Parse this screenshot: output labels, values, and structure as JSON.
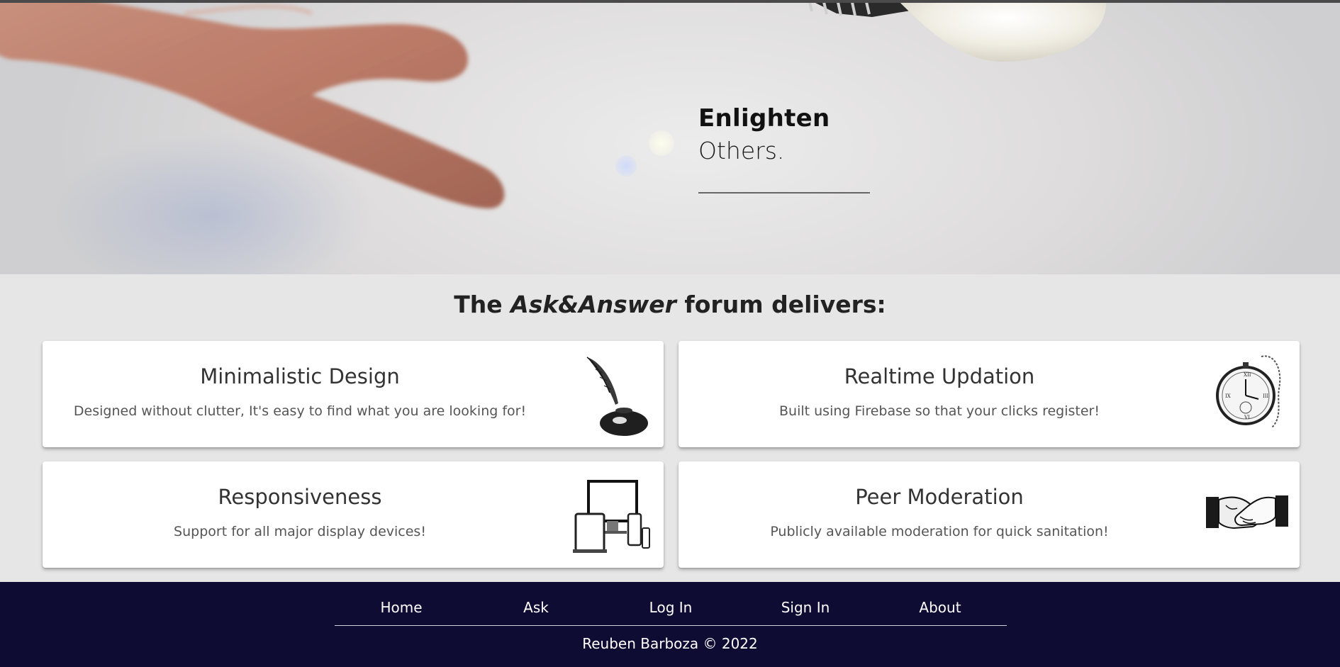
{
  "hero": {
    "line1": "Enlighten",
    "line2": "Others.",
    "illustration": "hand-reaching-lightbulb"
  },
  "features": {
    "title_prefix": "The",
    "title_brand": "Ask&Answer",
    "title_suffix": "forum delivers:",
    "cards": [
      {
        "title": "Minimalistic Design",
        "description": "Designed without clutter, It's easy to find what you are looking for!",
        "icon": "quill-inkwell-icon"
      },
      {
        "title": "Realtime Updation",
        "description": "Built using Firebase so that your clicks register!",
        "icon": "pocket-watch-icon"
      },
      {
        "title": "Responsiveness",
        "description": "Support for all major display devices!",
        "icon": "devices-icon"
      },
      {
        "title": "Peer Moderation",
        "description": "Publicly available moderation for quick sanitation!",
        "icon": "handshake-icon"
      }
    ]
  },
  "footer": {
    "nav": [
      "Home",
      "Ask",
      "Log In",
      "Sign In",
      "About"
    ],
    "copyright": "Reuben Barboza © 2022",
    "background": "#0f0c34"
  }
}
